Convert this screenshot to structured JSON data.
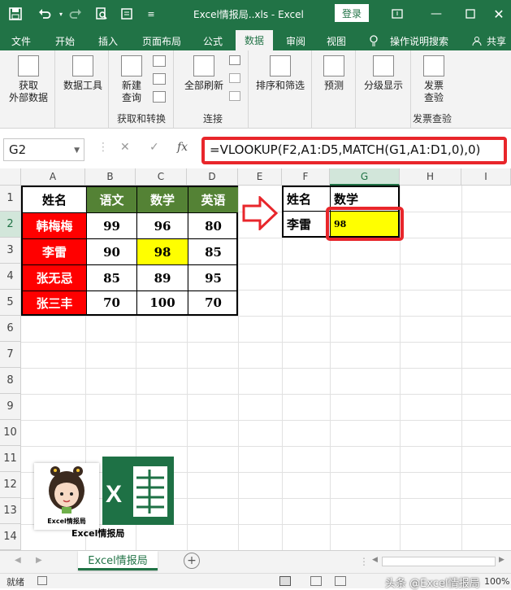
{
  "titlebar": {
    "title": "Excel情报局..xls  -  Excel",
    "login": "登录",
    "icons": [
      "save-icon",
      "undo-icon",
      "redo-icon",
      "print-preview-icon",
      "form-icon",
      "customize-icon",
      "ribbon-display-icon",
      "minimize-icon",
      "maximize-icon",
      "close-icon"
    ]
  },
  "tabs": [
    "文件",
    "开始",
    "插入",
    "页面布局",
    "公式",
    "数据",
    "审阅",
    "视图",
    "操作说明搜索",
    "共享"
  ],
  "active_tab": "数据",
  "ribbon": {
    "get_data": "获取\n外部数据",
    "data_tools": "数据工具",
    "new_query": "新建\n查询",
    "group_get_transform": "获取和转换",
    "refresh_all": "全部刷新",
    "group_connections": "连接",
    "sort_filter": "排序和筛选",
    "forecast": "预测",
    "outline": "分级显示",
    "publish_query": "发票\n查验",
    "group_invoice": "发票查验"
  },
  "formula_bar": {
    "name_box": "G2",
    "cancel": "✕",
    "enter": "✓",
    "fx": "fx",
    "formula": "=VLOOKUP(F2,A1:D5,MATCH(G1,A1:D1,0),0)"
  },
  "columns": [
    "A",
    "B",
    "C",
    "D",
    "E",
    "F",
    "G",
    "H",
    "I"
  ],
  "rows": [
    "1",
    "2",
    "3",
    "4",
    "5",
    "6",
    "7",
    "8",
    "9",
    "10",
    "11",
    "12",
    "13",
    "14"
  ],
  "table": {
    "headers": [
      "姓名",
      "语文",
      "数学",
      "英语"
    ],
    "rows": [
      [
        "韩梅梅",
        "99",
        "96",
        "80"
      ],
      [
        "李雷",
        "90",
        "98",
        "85"
      ],
      [
        "张无忌",
        "85",
        "89",
        "95"
      ],
      [
        "张三丰",
        "70",
        "100",
        "70"
      ]
    ]
  },
  "lookup": {
    "f1": "姓名",
    "g1": "数学",
    "f2": "李雷",
    "g2": "98"
  },
  "logo": {
    "avatar_caption": "Excel情报局",
    "caption": "Excel情报局"
  },
  "sheet_tab": "Excel情报局",
  "status": {
    "ready": "就绪",
    "watermark": "头条 @Excel情报局",
    "zoom": "100%"
  },
  "colors": {
    "excel_green": "#217346",
    "header_green": "#548235",
    "name_red": "#ff0000",
    "highlight_yellow": "#ffff00",
    "callout_red": "#e8262b"
  }
}
